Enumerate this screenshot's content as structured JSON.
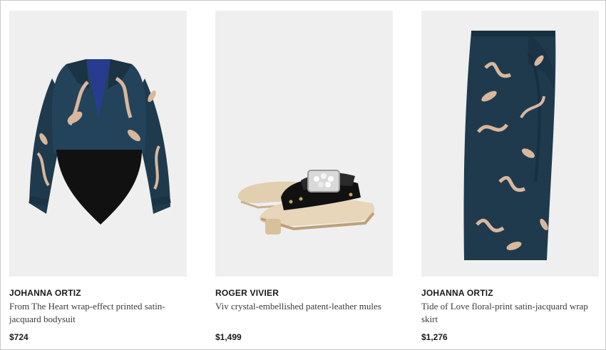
{
  "products": [
    {
      "brand": "JOHANNA ORTIZ",
      "description": "From The Heart wrap-effect printed satin-jacquard bodysuit",
      "price": "$724",
      "image_icon": "bodysuit-image"
    },
    {
      "brand": "ROGER VIVIER",
      "description": "Viv crystal-embellished patent-leather mules",
      "price": "$1,499",
      "image_icon": "mules-image"
    },
    {
      "brand": "JOHANNA ORTIZ",
      "description": "Tide of Love floral-print satin-jacquard wrap skirt",
      "price": "$1,276",
      "image_icon": "skirt-image"
    }
  ],
  "colors": {
    "image_bg": "#efefef",
    "fabric_navy": "#1f3a4d",
    "print_tan": "#d8b79c",
    "black": "#111111",
    "wood": "#e2cfb0"
  }
}
